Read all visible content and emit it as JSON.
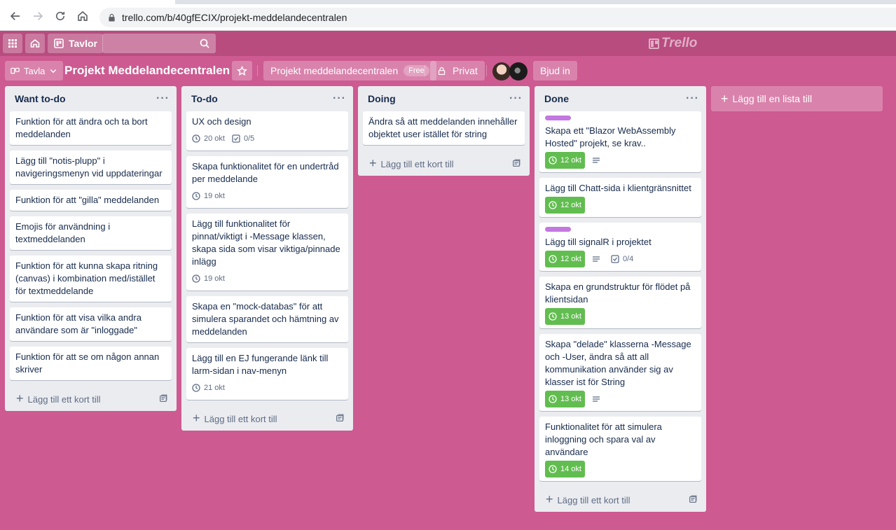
{
  "browser": {
    "url": "trello.com/b/40gfECIX/projekt-meddelandecentralen"
  },
  "header": {
    "boards_label": "Tavlor"
  },
  "board": {
    "view_label": "Tavla",
    "title": "Projekt Meddelandecentralen",
    "team_label": "Projekt meddelandecentralen",
    "team_badge": "Free",
    "privacy_label": "Privat",
    "invite_label": "Bjud in"
  },
  "add_card_label": "Lägg till ett kort till",
  "add_list_label": "Lägg till en lista till",
  "lists": [
    {
      "title": "Want to-do",
      "cards": [
        {
          "text": "Funktion för att ändra och ta bort meddelanden"
        },
        {
          "text": "Lägg till \"notis-plupp\" i navigeringsmenyn vid uppdateringar"
        },
        {
          "text": "Funktion för att \"gilla\" meddelanden"
        },
        {
          "text": "Emojis för användning i textmeddelanden"
        },
        {
          "text": "Funktion för att kunna skapa ritning (canvas) i kombination med/istället för textmeddelande"
        },
        {
          "text": "Funktion för att visa vilka andra användare som är \"inloggade\""
        },
        {
          "text": "Funktion för att se om någon annan skriver"
        }
      ]
    },
    {
      "title": "To-do",
      "cards": [
        {
          "text": "UX och design",
          "due": "20 okt",
          "checklist": "0/5"
        },
        {
          "text": "Skapa funktionalitet för en undertråd per meddelande",
          "due": "19 okt"
        },
        {
          "text": "Lägg till funktionalitet för pinnat/viktigt i -Message klassen, skapa sida som visar viktiga/pinnade inlägg",
          "due": "19 okt"
        },
        {
          "text": "Skapa en \"mock-databas\" för att simulera sparandet och hämtning av meddelanden"
        },
        {
          "text": "Lägg till en EJ fungerande länk till larm-sidan i nav-menyn",
          "due": "21 okt"
        }
      ]
    },
    {
      "title": "Doing",
      "cards": [
        {
          "text": "Ändra så att meddelanden innehåller objektet user istället för string"
        }
      ]
    },
    {
      "title": "Done",
      "cards": [
        {
          "text": "Skapa ett \"Blazor WebAssembly Hosted\" projekt, se krav..",
          "label": true,
          "due": "12 okt",
          "description": true
        },
        {
          "text": "Lägg till Chatt-sida i klientgränsnittet",
          "due": "12 okt"
        },
        {
          "text": "Lägg till signalR i projektet",
          "label": true,
          "due": "12 okt",
          "description": true,
          "checklist": "0/4"
        },
        {
          "text": "Skapa en grundstruktur för flödet på klientsidan",
          "due": "13 okt"
        },
        {
          "text": "Skapa \"delade\" klasserna -Message och -User, ändra så att all kommunikation använder sig av klasser ist för String",
          "due": "13 okt",
          "description": true
        },
        {
          "text": "Funktionalitet för att simulera inloggning och spara val av användare",
          "due": "14 okt"
        }
      ]
    }
  ],
  "colors": {
    "board_bg": "#cd5a91",
    "header_bg": "#b84c7f",
    "label_purple": "#c377e0",
    "due_complete": "#61bd4f"
  }
}
